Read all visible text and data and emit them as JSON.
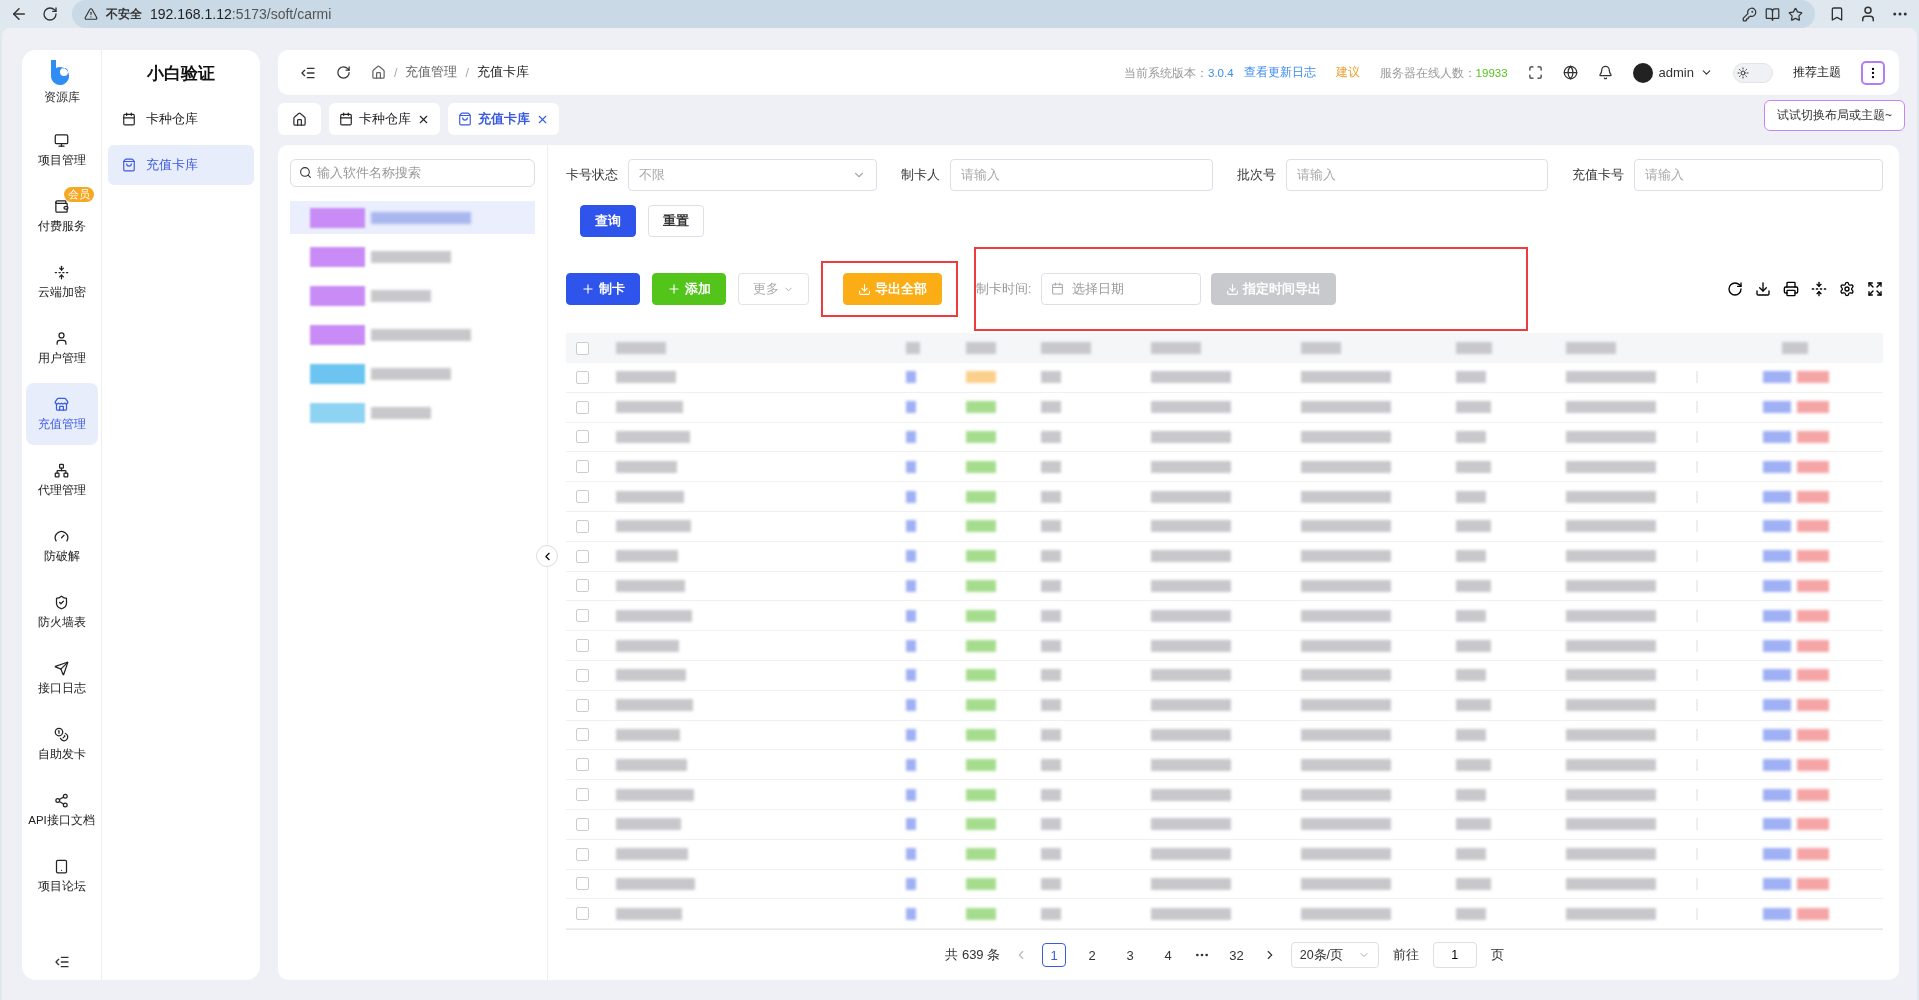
{
  "browser": {
    "security_label": "不安全",
    "url_host": "192.168.1.12",
    "url_path": ":5173/soft/carmi"
  },
  "rail": {
    "logo_label": "资源库",
    "items": [
      {
        "label": "项目管理",
        "selected": false
      },
      {
        "label": "付费服务",
        "selected": false,
        "badge": "会员"
      },
      {
        "label": "云端加密",
        "selected": false
      },
      {
        "label": "用户管理",
        "selected": false
      },
      {
        "label": "充值管理",
        "selected": true
      },
      {
        "label": "代理管理",
        "selected": false
      },
      {
        "label": "防破解",
        "selected": false
      },
      {
        "label": "防火墙表",
        "selected": false
      },
      {
        "label": "接口日志",
        "selected": false
      },
      {
        "label": "自助发卡",
        "selected": false
      },
      {
        "label": "API接口文档",
        "selected": false
      },
      {
        "label": "项目论坛",
        "selected": false
      }
    ]
  },
  "submenu": {
    "title": "小白验证",
    "items": [
      {
        "label": "卡种仓库",
        "selected": false
      },
      {
        "label": "充值卡库",
        "selected": true
      }
    ]
  },
  "header": {
    "breadcrumb": [
      "充值管理",
      "充值卡库"
    ],
    "breadcrumb_separator": "/",
    "version_label": "当前系统版本：",
    "version": "3.0.4",
    "changelog_link": "查看更新日志",
    "suggest_link": "建议",
    "online_label": "服务器在线人数：",
    "online_count": "19933",
    "user": "admin",
    "dark_mode": false,
    "theme_button": "推荐主题",
    "tooltip": "试试切换布局或主题~"
  },
  "tabs": [
    {
      "label": "卡种仓库",
      "selected": false
    },
    {
      "label": "充值卡库",
      "selected": true
    }
  ],
  "software_list": {
    "placeholder": "输入软件名称搜索",
    "items": [
      {
        "selected": true,
        "color": "#c98cf7"
      },
      {
        "selected": false,
        "color": "#c98cf7"
      },
      {
        "selected": false,
        "color": "#c98cf7"
      },
      {
        "selected": false,
        "color": "#c98cf7"
      },
      {
        "selected": false,
        "color": "#6cc5f0"
      },
      {
        "selected": false,
        "color": "#8fd3f2"
      }
    ]
  },
  "filters": [
    {
      "label": "卡号状态",
      "kind": "select",
      "value": "不限"
    },
    {
      "label": "制卡人",
      "kind": "input",
      "placeholder": "请输入"
    },
    {
      "label": "批次号",
      "kind": "input",
      "placeholder": "请输入"
    },
    {
      "label": "充值卡号",
      "kind": "input",
      "placeholder": "请输入"
    }
  ],
  "query_button": "查询",
  "reset_button": "重置",
  "toolbar": {
    "make_card": "制卡",
    "add": "添加",
    "more": "更多",
    "export_all": "导出全部",
    "time_label": "制卡时间:",
    "date_placeholder": "选择日期",
    "export_range": "指定时间导出",
    "export_range_disabled": true
  },
  "table": {
    "all_checked": false,
    "rows": [
      {
        "checked": false,
        "color": "#fbd08c"
      },
      {
        "checked": false,
        "color": "#a6dc8e"
      },
      {
        "checked": false,
        "color": "#a6dc8e"
      },
      {
        "checked": false,
        "color": "#a6dc8e"
      },
      {
        "checked": false,
        "color": "#a6dc8e"
      },
      {
        "checked": false,
        "color": "#a6dc8e"
      },
      {
        "checked": false,
        "color": "#a6dc8e"
      },
      {
        "checked": false,
        "color": "#a6dc8e"
      },
      {
        "checked": false,
        "color": "#a6dc8e"
      },
      {
        "checked": false,
        "color": "#a6dc8e"
      },
      {
        "checked": false,
        "color": "#a6dc8e"
      },
      {
        "checked": false,
        "color": "#a6dc8e"
      },
      {
        "checked": false,
        "color": "#a6dc8e"
      },
      {
        "checked": false,
        "color": "#a6dc8e"
      },
      {
        "checked": false,
        "color": "#a6dc8e"
      },
      {
        "checked": false,
        "color": "#a6dc8e"
      },
      {
        "checked": false,
        "color": "#a6dc8e"
      },
      {
        "checked": false,
        "color": "#a6dc8e"
      },
      {
        "checked": false,
        "color": "#a6dc8e"
      }
    ]
  },
  "pagination": {
    "total": "共 639 条",
    "pages": [
      {
        "kind": "page",
        "label": "1",
        "selected": true
      },
      {
        "kind": "page",
        "label": "2",
        "selected": false
      },
      {
        "kind": "page",
        "label": "3",
        "selected": false
      },
      {
        "kind": "page",
        "label": "4",
        "selected": false
      },
      {
        "kind": "ellipsis"
      },
      {
        "kind": "page",
        "label": "32",
        "selected": false
      }
    ],
    "page_size": "20条/页",
    "goto_label": "前往",
    "goto_value": "1",
    "page_unit": "页"
  }
}
